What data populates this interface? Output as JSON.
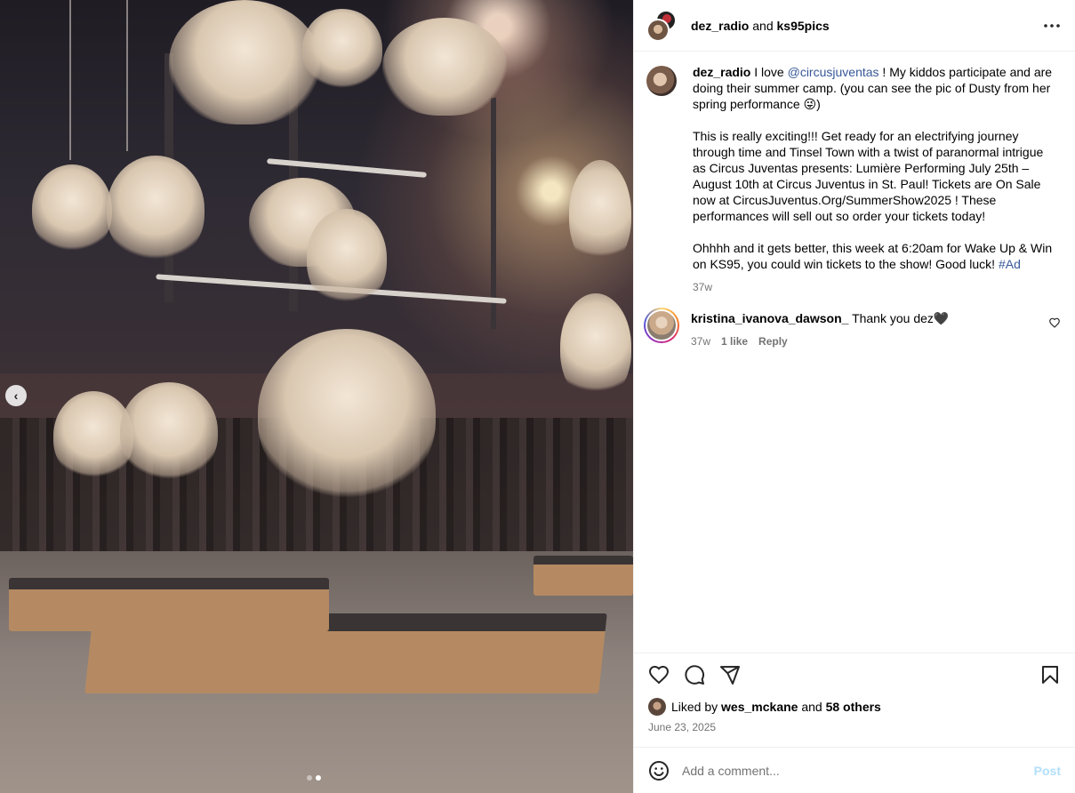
{
  "header": {
    "user_one": "dez_radio",
    "joiner": "and",
    "user_two": "ks95pics",
    "more_icon": "more-horizontal-icon"
  },
  "caption": {
    "username": "dez_radio",
    "text_before_mention": "I love",
    "mention": "@circusjuventas",
    "text_after_mention": "! My kiddos participate and are doing their summer camp. (you can see the pic of Dusty from her spring performance 😜)",
    "paragraph_two": "This is really exciting!!! Get ready for an electrifying journey through time and Tinsel Town with a twist of paranormal intrigue as Circus Juventas presents: Lumière Performing July 25th – August 10th at Circus Juventus in St. Paul! Tickets are On Sale now at CircusJuventus.Org/SummerShow2025 ! These performances will sell out so order your tickets today!",
    "paragraph_three": "Ohhhh and it gets better, this week at 6:20am for Wake Up & Win on KS95, you could win tickets to the show! Good luck!",
    "hashtag": "#Ad",
    "age": "37w"
  },
  "comment": {
    "username": "kristina_ivanova_dawson_",
    "text": "Thank you dez🖤",
    "age": "37w",
    "likes": "1 like",
    "reply": "Reply"
  },
  "likes": {
    "prefix": "Liked by",
    "user": "wes_mckane",
    "joiner": "and",
    "others": "58 others"
  },
  "date": "June 23, 2025",
  "composer": {
    "placeholder": "Add a comment...",
    "post": "Post"
  },
  "carousel": {
    "prev_glyph": "‹",
    "slides": 2,
    "active_slide": 2
  },
  "colors": {
    "link": "#385898",
    "post_button": "#b2dffc",
    "muted": "#737373"
  }
}
